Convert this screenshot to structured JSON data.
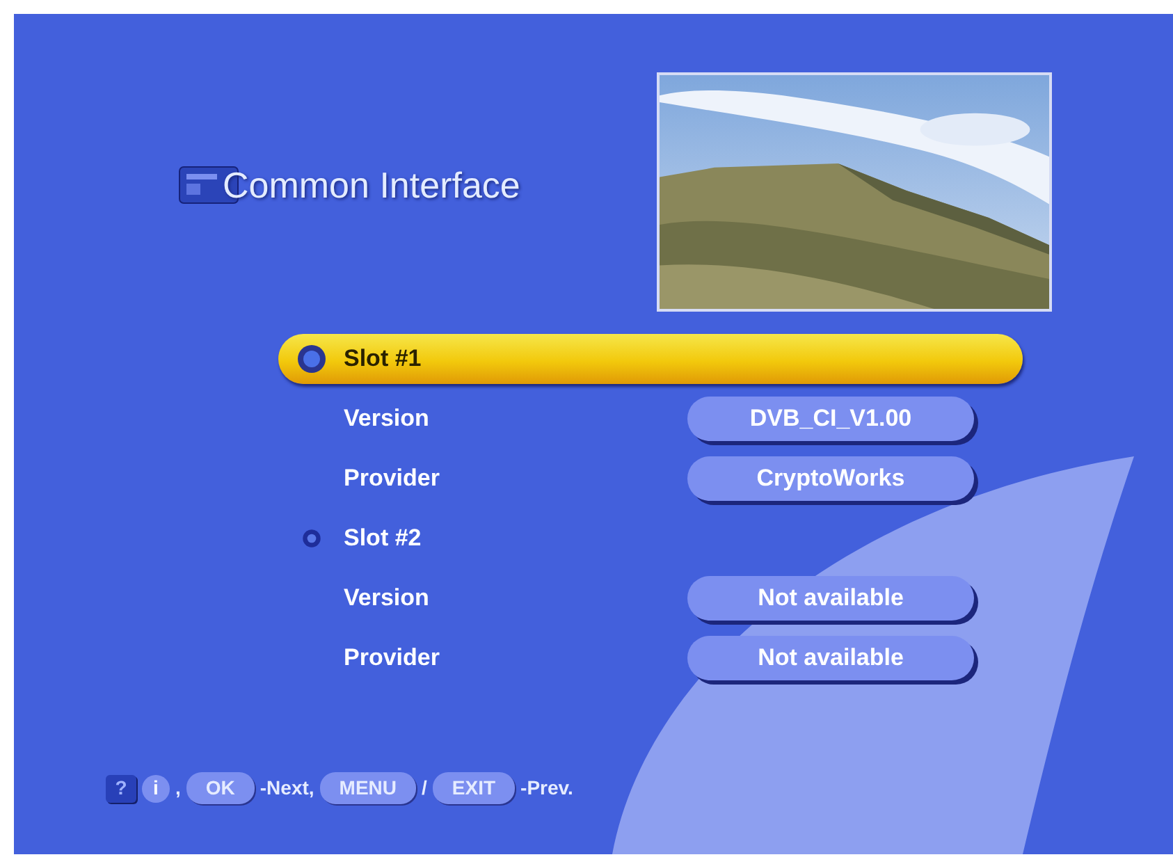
{
  "title": "Common Interface",
  "slots": [
    {
      "label": "Slot #1",
      "selected": true,
      "fields": [
        {
          "label": "Version",
          "value": "DVB_CI_V1.00"
        },
        {
          "label": "Provider",
          "value": "CryptoWorks"
        }
      ]
    },
    {
      "label": "Slot #2",
      "selected": false,
      "fields": [
        {
          "label": "Version",
          "value": "Not available"
        },
        {
          "label": "Provider",
          "value": "Not available"
        }
      ]
    }
  ],
  "footer": [
    {
      "kind": "help",
      "text": "?"
    },
    {
      "kind": "info",
      "text": "i"
    },
    {
      "kind": "text",
      "text": ","
    },
    {
      "kind": "key",
      "text": "OK"
    },
    {
      "kind": "text",
      "text": "-Next,"
    },
    {
      "kind": "key",
      "text": "MENU"
    },
    {
      "kind": "text",
      "text": "/"
    },
    {
      "kind": "key",
      "text": "EXIT"
    },
    {
      "kind": "text",
      "text": "-Prev."
    }
  ]
}
